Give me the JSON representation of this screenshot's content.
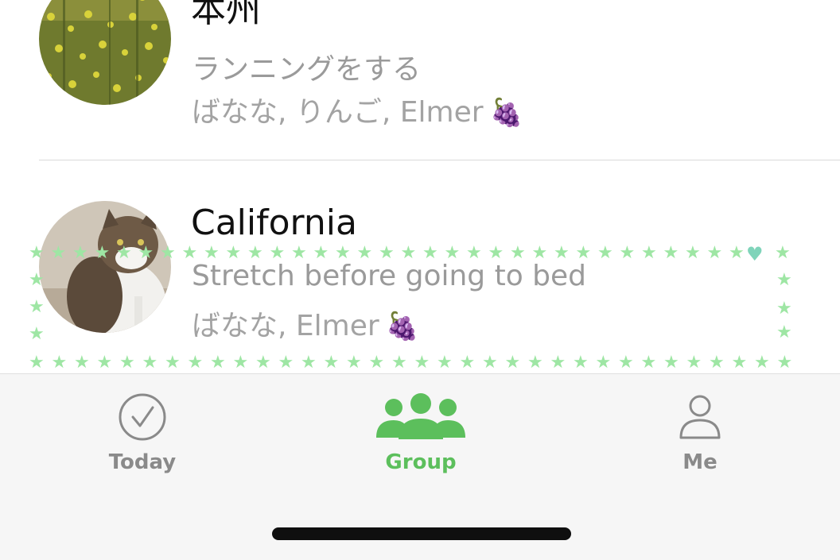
{
  "groups": [
    {
      "title": "本州",
      "task": "ランニングをする",
      "members": "ばなな, りんご, Elmer",
      "badge_icon": "grapes-icon",
      "badge": "🍇",
      "avatar": "rapeseed-field-photo"
    },
    {
      "title": "California",
      "task": "Stretch before going to bed",
      "members": "ばなな, Elmer",
      "badge_icon": "grapes-icon",
      "badge": "🍇",
      "avatar": "cat-photo"
    }
  ],
  "decoration": {
    "star": "★",
    "heart": "♥",
    "color": "#9ee6a4",
    "heart_color": "#7fd4ba"
  },
  "tabs": [
    {
      "label": "Today",
      "icon": "checkmark-circle-icon",
      "color": "#8a8a8a",
      "active": false
    },
    {
      "label": "Group",
      "icon": "group-people-icon",
      "color": "#5cbf5c",
      "active": true
    },
    {
      "label": "Me",
      "icon": "person-icon",
      "color": "#8a8a8a",
      "active": false
    }
  ]
}
